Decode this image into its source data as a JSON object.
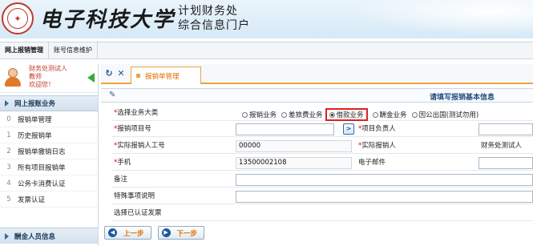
{
  "banner": {
    "university": "电子科技大学",
    "portal_line1": "计划财务处",
    "portal_line2": "综合信息门户"
  },
  "topnav": [
    {
      "label": "网上报销管理"
    },
    {
      "label": "账号信息维护"
    }
  ],
  "user": {
    "line1": "财务处测试人",
    "line2": "教师",
    "line3": "欢迎您！"
  },
  "sidebar": {
    "header": "网上报账业务",
    "items": [
      {
        "num": "0",
        "label": "报销单管理"
      },
      {
        "num": "1",
        "label": "历史报销单"
      },
      {
        "num": "2",
        "label": "报销单撤销日志"
      },
      {
        "num": "3",
        "label": "所有项目报销单"
      },
      {
        "num": "4",
        "label": "公务卡消费认证"
      },
      {
        "num": "5",
        "label": "发票认证"
      }
    ],
    "footer": "酬金人员信息"
  },
  "tabbar": {
    "refresh_icon": "↻",
    "close_icon": "✕",
    "active_tab": "报销单管理"
  },
  "form": {
    "title": "请填写报销基本信息",
    "business_type_label": "选择业务大类",
    "business_types": [
      {
        "label": "报销业务",
        "selected": false
      },
      {
        "label": "差旅费业务",
        "selected": false
      },
      {
        "label": "借款业务",
        "selected": true
      },
      {
        "label": "酬金业务",
        "selected": false
      },
      {
        "label": "因公出国(测试勿用)",
        "selected": false
      }
    ],
    "project_no_label": "报销项目号",
    "project_no_value": "",
    "go_button": ">",
    "project_lead_label": "项目负责人",
    "project_lead_value": "",
    "emp_id_label": "实际报销人工号",
    "emp_id_value": "00000",
    "actual_person_label": "实际报销人",
    "actual_person_value": "财务处测试人",
    "phone_label": "手机",
    "phone_value": "13500002108",
    "email_label": "电子邮件",
    "email_value": "",
    "remark_label": "备注",
    "remark_value": "",
    "special_label": "特殊事项说明",
    "special_value": "",
    "invoice_label": "选择已认证发票"
  },
  "buttons": {
    "prev": "上一步",
    "next": "下一步"
  }
}
